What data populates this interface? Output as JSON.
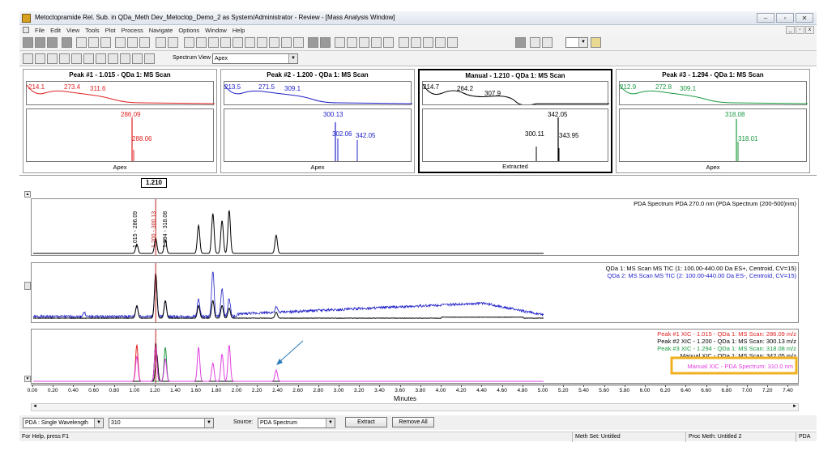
{
  "window": {
    "title": "Metoclopramide Rel. Sub. in QDa_Meth Dev_Metoclop_Demo_2 as System/Administrator - Review - [Mass Analysis Window]"
  },
  "menu": [
    "File",
    "Edit",
    "View",
    "Tools",
    "Plot",
    "Process",
    "Navigate",
    "Options",
    "Window",
    "Help"
  ],
  "toolbar": {
    "spectrum_view_label": "Spectrum View",
    "spectrum_view_value": "Apex"
  },
  "panels": [
    {
      "title": "Peak #1 - 1.015 - QDa 1: MS Scan",
      "footer": "Apex",
      "color": "#e02020",
      "top_labels": [
        "214.1",
        "273.4",
        "311.6"
      ],
      "ms_labels": [
        "286.09",
        "288.06"
      ]
    },
    {
      "title": "Peak #2 - 1.200 - QDa 1: MS Scan",
      "footer": "Apex",
      "color": "#2020c8",
      "top_labels": [
        "213.5",
        "271.5",
        "309.1"
      ],
      "ms_labels": [
        "300.13",
        "302.06",
        "342.05"
      ]
    },
    {
      "title": "Manual - 1.210 - QDa 1: MS Scan",
      "footer": "Extracted",
      "color": "#000000",
      "top_labels": [
        "214.7",
        "264.2",
        "307.9"
      ],
      "ms_labels": [
        "342.05",
        "300.11",
        "343.95"
      ]
    },
    {
      "title": "Peak #3 - 1.294 - QDa 1: MS Scan",
      "footer": "Apex",
      "color": "#1a9a40",
      "top_labels": [
        "212.9",
        "272.8",
        "309.1"
      ],
      "ms_labels": [
        "318.08",
        "318.01"
      ]
    }
  ],
  "cursor_time": "1.210",
  "chart_data": [
    {
      "type": "line",
      "legend": [
        "PDA Spectrum PDA 270.0 nm (PDA Spectrum (200-500)nm)"
      ],
      "peak_labels": [
        "1.015 - 286.09",
        "1.200 - 300.13",
        "1.294 - 318.08"
      ],
      "peaks": [
        {
          "x": 1.015,
          "y": 0.2
        },
        {
          "x": 1.2,
          "y": 0.34
        },
        {
          "x": 1.294,
          "y": 0.3
        },
        {
          "x": 1.62,
          "y": 0.62
        },
        {
          "x": 1.76,
          "y": 0.88
        },
        {
          "x": 1.85,
          "y": 0.72
        },
        {
          "x": 1.92,
          "y": 0.95
        },
        {
          "x": 2.38,
          "y": 0.4
        }
      ],
      "color": "#000000"
    },
    {
      "type": "line",
      "series": [
        {
          "name": "QDa 1: MS Scan MS TIC (1: 100.00-440.00 Da ES+, Centroid, CV=15)",
          "color": "#000000"
        },
        {
          "name": "QDa 2: MS Scan MS TIC (2: 100.00-440.00 Da ES-, Centroid, CV=15)",
          "color": "#2020c8"
        }
      ]
    },
    {
      "type": "line",
      "series": [
        {
          "name": "Peak #1 XIC - 1.015 - QDa 1: MS Scan: 286.09 m/z",
          "color": "#e02020"
        },
        {
          "name": "Peak #2 XIC - 1.200 - QDa 1: MS Scan: 300.13 m/z",
          "color": "#000000"
        },
        {
          "name": "Peak #3 XIC - 1.294 - QDa 1: MS Scan: 318.08 m/z",
          "color": "#1a9a40"
        },
        {
          "name": "Manual XIC - QDa 1: MS Scan: 342.05 m/z",
          "color": "#000000"
        },
        {
          "name": "Manual XIC - PDA Spectrum: 310.0 nm",
          "color": "#e040e0"
        }
      ]
    }
  ],
  "xaxis": {
    "label": "Minutes",
    "ticks": [
      "0.00",
      "0.20",
      "0.40",
      "0.60",
      "0.80",
      "1.00",
      "1.20",
      "1.40",
      "1.60",
      "1.80",
      "2.00",
      "2.20",
      "2.40",
      "2.60",
      "2.80",
      "3.00",
      "3.20",
      "3.40",
      "3.60",
      "3.80",
      "4.00",
      "4.20",
      "4.40",
      "4.60",
      "4.80",
      "5.00",
      "5.20",
      "5.40",
      "5.60",
      "5.80",
      "6.00",
      "6.20",
      "6.40",
      "6.60",
      "6.80",
      "7.00",
      "7.20",
      "7.40"
    ]
  },
  "bottom": {
    "channel_mode": "PDA : Single Wavelength",
    "wavelength": "310",
    "source_label": "Source:",
    "source_value": "PDA Spectrum",
    "extract_label": "Extract",
    "remove_all_label": "Remove All"
  },
  "status": {
    "help": "For Help, press F1",
    "meth_set": "Meth Set: Untitled",
    "proc_meth": "Proc Meth: Untitled 2",
    "mode": "PDA"
  },
  "colors": {
    "highlight_box": "#f0b020",
    "arrow": "#2a7ab8"
  }
}
